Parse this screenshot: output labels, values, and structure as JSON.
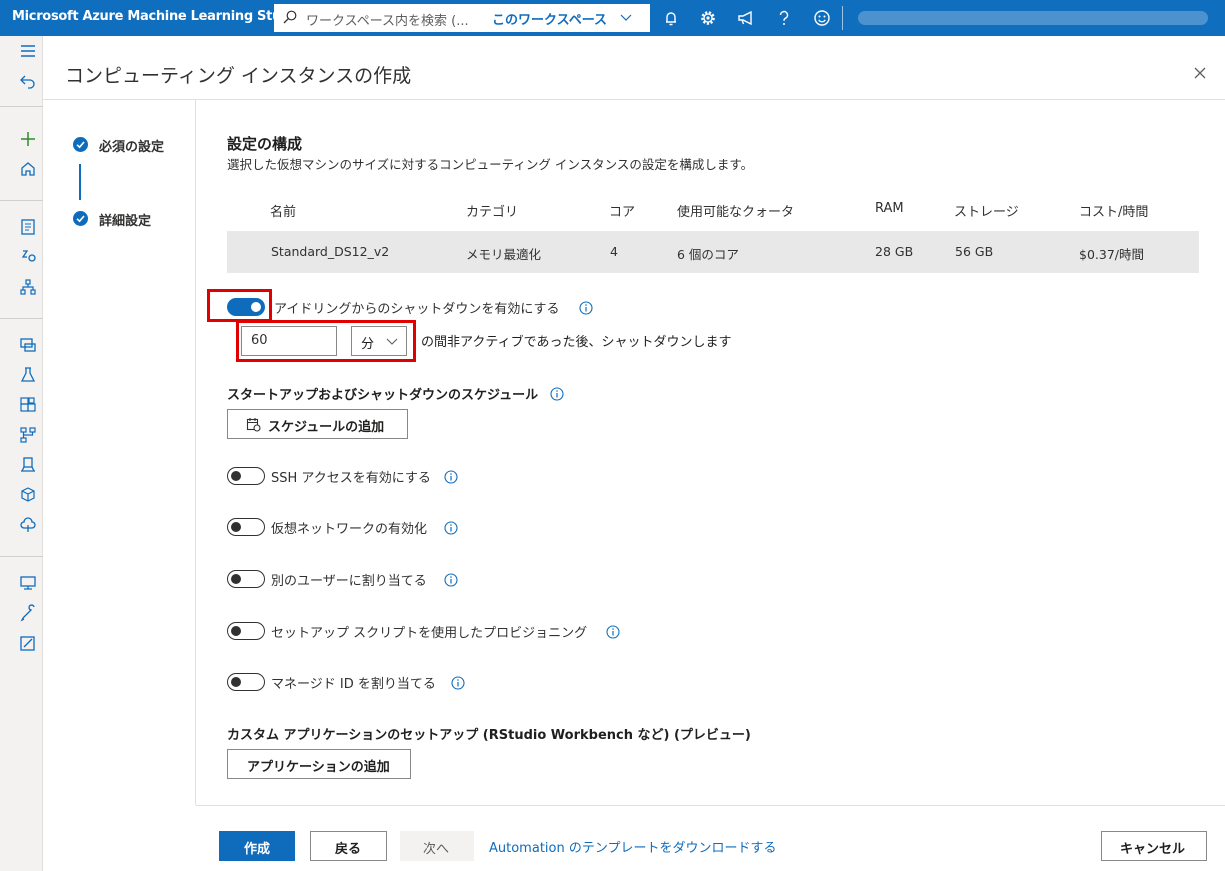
{
  "app": {
    "title": "Microsoft Azure Machine Learning Studio"
  },
  "search": {
    "placeholder": "ワークスペース内を検索 (...",
    "scope": "このワークスペース"
  },
  "topbar_icons": [
    "bell-icon",
    "gear-icon",
    "megaphone-icon",
    "help-icon",
    "smiley-icon"
  ],
  "panel": {
    "title": "コンピューティング インスタンスの作成"
  },
  "steps": [
    {
      "label": "必須の設定",
      "status": "complete"
    },
    {
      "label": "詳細設定",
      "status": "complete"
    }
  ],
  "config": {
    "title": "設定の構成",
    "description": "選択した仮想マシンのサイズに対するコンピューティング インスタンスの設定を構成します。"
  },
  "vm_table": {
    "columns": [
      "名前",
      "カテゴリ",
      "コア",
      "使用可能なクォータ",
      "RAM",
      "ストレージ",
      "コスト/時間"
    ],
    "row": [
      "Standard_DS12_v2",
      "メモリ最適化",
      "4",
      "6 個のコア",
      "28 GB",
      "56 GB",
      "$0.37/時間"
    ]
  },
  "idle_shutdown": {
    "label": "アイドリングからのシャットダウンを有効にする",
    "enabled": true,
    "value": "60",
    "unit": "分",
    "suffix": "の間非アクティブであった後、シャットダウンします"
  },
  "schedule": {
    "title": "スタートアップおよびシャットダウンのスケジュール",
    "button": "スケジュールの追加"
  },
  "toggles": [
    {
      "label": "SSH アクセスを有効にする",
      "enabled": false
    },
    {
      "label": "仮想ネットワークの有効化",
      "enabled": false
    },
    {
      "label": "別のユーザーに割り当てる",
      "enabled": false
    },
    {
      "label": "セットアップ スクリプトを使用したプロビジョニング",
      "enabled": false
    },
    {
      "label": "マネージド ID を割り当てる",
      "enabled": false
    }
  ],
  "custom_apps": {
    "title": "カスタム アプリケーションのセットアップ (RStudio Workbench など) (プレビュー)",
    "button": "アプリケーションの追加"
  },
  "footer": {
    "create": "作成",
    "back": "戻る",
    "next": "次へ",
    "template_link": "Automation のテンプレートをダウンロードする",
    "cancel": "キャンセル"
  },
  "colors": {
    "accent": "#0f6cbd",
    "highlight_box": "#e00000"
  }
}
